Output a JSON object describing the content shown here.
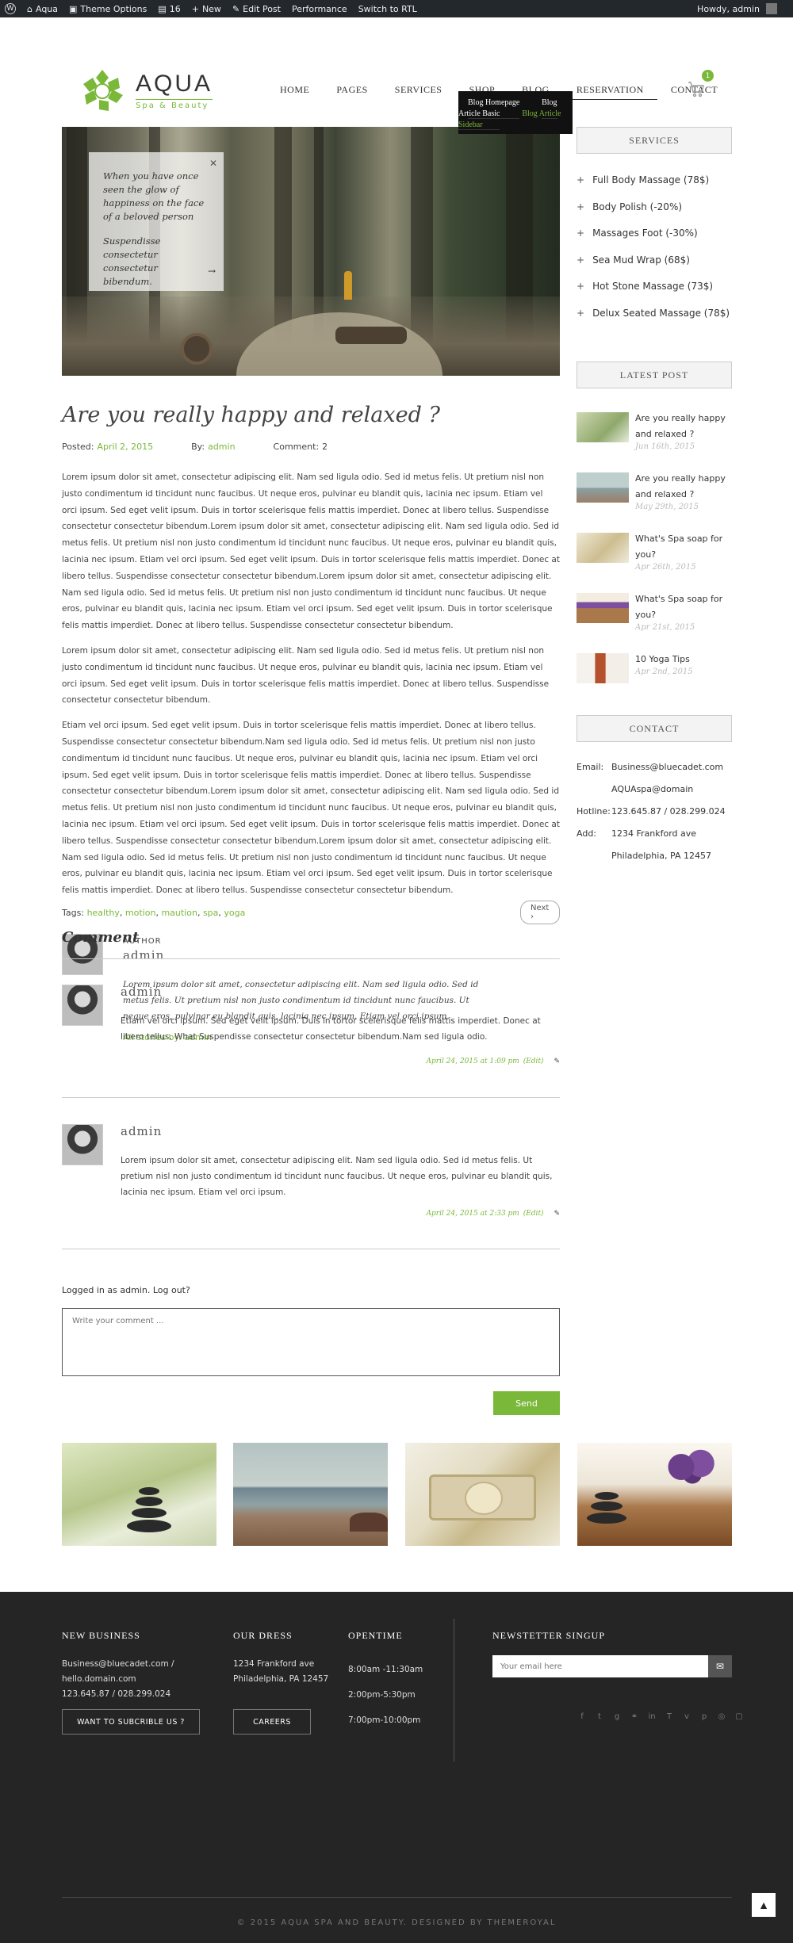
{
  "admin_bar": {
    "site": "Aqua",
    "theme_options": "Theme Options",
    "comments_count": "16",
    "new": "New",
    "edit_post": "Edit Post",
    "performance": "Performance",
    "rtl": "Switch to RTL",
    "howdy": "Howdy, admin"
  },
  "brand": {
    "name": "AQUA",
    "tagline": "Spa & Beauty",
    "accent": "#7ab83a"
  },
  "nav": [
    {
      "label": "HOME"
    },
    {
      "label": "PAGES"
    },
    {
      "label": "SERVICES"
    },
    {
      "label": "SHOP"
    },
    {
      "label": "BLOG"
    },
    {
      "label": "RESERVATION"
    },
    {
      "label": "CONTACT"
    }
  ],
  "cart": {
    "count": "1"
  },
  "blog_dropdown": [
    "Blog Homepage",
    "Blog Article Basic",
    "Blog Article Sidebar"
  ],
  "hero": {
    "quote": "When you have once seen the glow of happiness on the face of a beloved person",
    "sub": "Suspendisse consectetur consectetur bibendum."
  },
  "post": {
    "title": "Are you really happy and relaxed ?",
    "posted_label": "Posted:",
    "posted_date": "April 2, 2015",
    "by_label": "By:",
    "author": "admin",
    "comment_label": "Comment:",
    "comment_count": "2",
    "p1": "Lorem ipsum dolor sit amet, consectetur adipiscing elit. Nam sed ligula odio. Sed id metus felis. Ut pretium nisl non justo condimentum id tincidunt nunc faucibus. Ut neque eros, pulvinar eu blandit quis, lacinia nec ipsum. Etiam vel orci ipsum. Sed eget velit ipsum. Duis in tortor scelerisque felis mattis imperdiet. Donec at libero tellus. Suspendisse consectetur consectetur bibendum.Lorem ipsum dolor sit amet, consectetur adipiscing elit. Nam sed ligula odio. Sed id metus felis. Ut pretium nisl non justo condimentum id tincidunt nunc faucibus. Ut neque eros, pulvinar eu blandit quis, lacinia nec ipsum. Etiam vel orci ipsum. Sed eget velit ipsum. Duis in tortor scelerisque felis mattis imperdiet. Donec at libero tellus. Suspendisse consectetur consectetur bibendum.Lorem ipsum dolor sit amet, consectetur adipiscing elit. Nam sed ligula odio. Sed id metus felis. Ut pretium nisl non justo condimentum id tincidunt nunc faucibus. Ut neque eros, pulvinar eu blandit quis, lacinia nec ipsum. Etiam vel orci ipsum. Sed eget velit ipsum. Duis in tortor scelerisque felis mattis imperdiet. Donec at libero tellus. Suspendisse consectetur consectetur bibendum.",
    "p2": "Lorem ipsum dolor sit amet, consectetur adipiscing elit. Nam sed ligula odio. Sed id metus felis. Ut pretium nisl non justo condimentum id tincidunt nunc faucibus. Ut neque eros, pulvinar eu blandit quis, lacinia nec ipsum. Etiam vel orci ipsum. Sed eget velit ipsum. Duis in tortor scelerisque felis mattis imperdiet. Donec at libero tellus. Suspendisse consectetur consectetur bibendum.",
    "p3": "Etiam vel orci ipsum. Sed eget velit ipsum. Duis in tortor scelerisque felis mattis imperdiet. Donec at libero tellus. Suspendisse consectetur consectetur bibendum.Nam sed ligula odio. Sed id metus felis. Ut pretium nisl non justo condimentum id tincidunt nunc faucibus. Ut neque eros, pulvinar eu blandit quis, lacinia nec ipsum. Etiam vel orci ipsum. Sed eget velit ipsum. Duis in tortor scelerisque felis mattis imperdiet. Donec at libero tellus. Suspendisse consectetur consectetur bibendum.Lorem ipsum dolor sit amet, consectetur adipiscing elit. Nam sed ligula odio. Sed id metus felis. Ut pretium nisl non justo condimentum id tincidunt nunc faucibus. Ut neque eros, pulvinar eu blandit quis, lacinia nec ipsum. Etiam vel orci ipsum. Sed eget velit ipsum. Duis in tortor scelerisque felis mattis imperdiet. Donec at libero tellus. Suspendisse consectetur consectetur bibendum.Lorem ipsum dolor sit amet, consectetur adipiscing elit. Nam sed ligula odio. Sed id metus felis. Ut pretium nisl non justo condimentum id tincidunt nunc faucibus. Ut neque eros, pulvinar eu blandit quis, lacinia nec ipsum. Etiam vel orci ipsum. Sed eget velit ipsum. Duis in tortor scelerisque felis mattis imperdiet. Donec at libero tellus. Suspendisse consectetur consectetur bibendum.",
    "tags_label": "Tags:",
    "tags": [
      "healthy",
      "motion",
      "maution",
      "spa",
      "yoga"
    ]
  },
  "author_box": {
    "role": "AUTHOR",
    "name": "admin",
    "bio": "Lorem ipsum dolor sit amet, consectetur adipiscing elit. Nam sed ligula odio. Sed id metus felis. Ut pretium nisl non justo condimentum id tincidunt nunc faucibus. Ut neque eros, pulvinar eu blandit quis, lacinia nec ipsum. Etiam vel orci ipsum.",
    "stories": "All stories by: admin"
  },
  "next": "Next",
  "comments": {
    "heading": "Comment",
    "items": [
      {
        "author": "admin",
        "text": "Etiam vel orci ipsum. Sed eget velit ipsum. Duis in tortor scelerisque felis mattis imperdiet. Donec at libero tellus. What Suspendisse consectetur consectetur bibendum.Nam sed ligula odio.",
        "date": "April 24, 2015 at 1:09 pm",
        "edit": "(Edit)"
      },
      {
        "author": "admin",
        "text": "Lorem ipsum dolor sit amet, consectetur adipiscing elit. Nam sed ligula odio. Sed id metus felis. Ut pretium nisl non justo condimentum id tincidunt nunc faucibus. Ut neque eros, pulvinar eu blandit quis, lacinia nec ipsum. Etiam vel orci ipsum.",
        "date": "April 24, 2015 at 2:33 pm",
        "edit": "(Edit)"
      }
    ],
    "logged_in": "Logged in as admin. Log out?",
    "placeholder": "Write your comment ...",
    "send": "Send"
  },
  "sidebar": {
    "services_title": "SERVICES",
    "services": [
      "Full Body Massage (78$)",
      "Body Polish (-20%)",
      "Massages Foot (-30%)",
      "Sea Mud Wrap (68$)",
      "Hot Stone Massage (73$)",
      "Delux Seated Massage (78$)"
    ],
    "latest_title": "LATEST POST",
    "latest": [
      {
        "title": "Are you really happy and relaxed ?",
        "date": "Jun 16th, 2015"
      },
      {
        "title": "Are you really happy and relaxed ?",
        "date": "May 29th, 2015"
      },
      {
        "title": "What's Spa soap for you?",
        "date": "Apr 26th, 2015"
      },
      {
        "title": "What's Spa soap for you?",
        "date": "Apr 21st, 2015"
      },
      {
        "title": "10 Yoga Tips",
        "date": "Apr 2nd, 2015"
      }
    ],
    "contact_title": "CONTACT",
    "contact": {
      "email_label": "Email:",
      "email1": "Business@bluecadet.com",
      "email2": "AQUAspa@domain",
      "hotline_label": "Hotline:",
      "hotline": "123.645.87 / 028.299.024",
      "add_label": "Add:",
      "addr1": "1234 Frankford ave",
      "addr2": "Philadelphia, PA 12457"
    }
  },
  "footer": {
    "col1_title": "NEW BUSINESS",
    "col1_lines": [
      "Business@bluecadet.com /",
      "hello.domain.com",
      "123.645.87 / 028.299.024"
    ],
    "col1_btn": "WANT TO SUBCRIBLE US ?",
    "col2_title": "OUR DRESS",
    "col2_lines": [
      "1234 Frankford ave",
      "Philadelphia, PA 12457"
    ],
    "col2_btn": "CAREERS",
    "col3_title": "OPENTIME",
    "col3_lines": [
      "8:00am -11:30am",
      "2:00pm-5:30pm",
      "7:00pm-10:00pm"
    ],
    "col4_title": "NEWSTETTER SINGUP",
    "email_placeholder": "Your email here",
    "copyright": "© 2015 AQUA SPA AND BEAUTY. DESIGNED BY THEMEROYAL"
  }
}
